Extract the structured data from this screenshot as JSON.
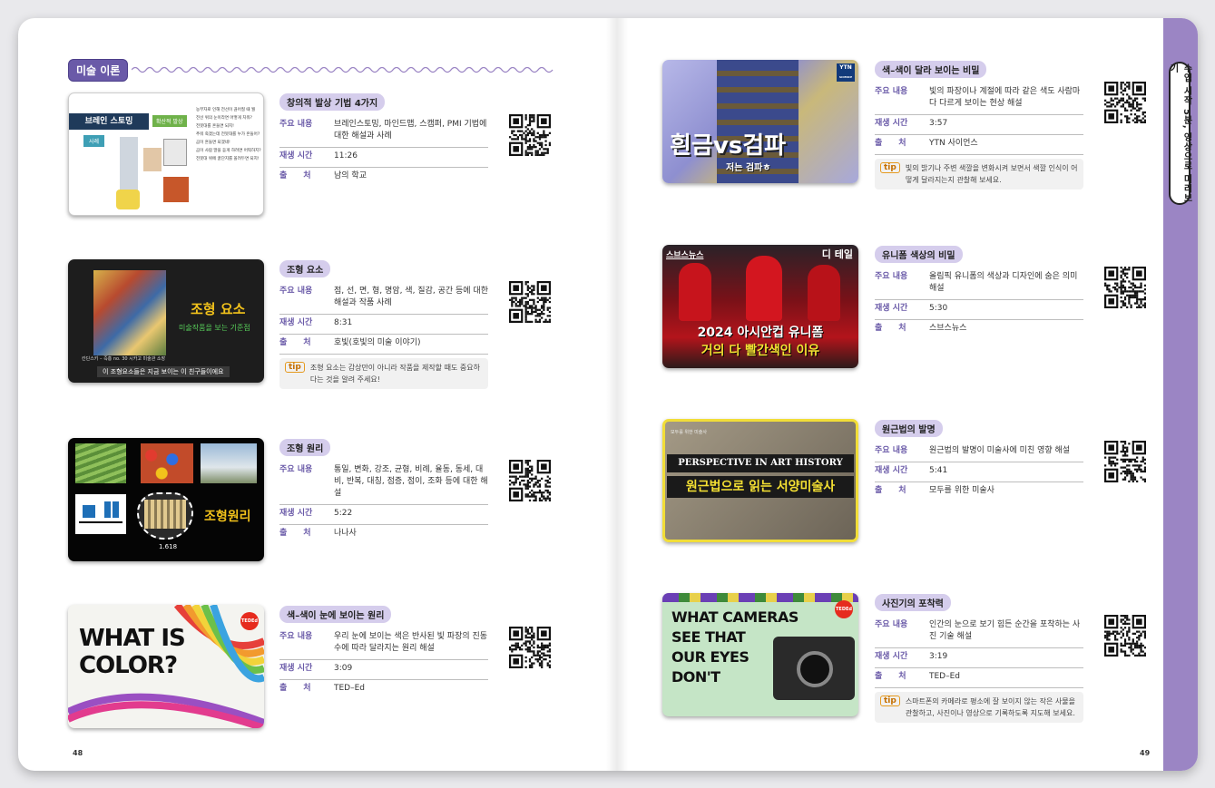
{
  "sidebar": {
    "label": "수업 시작 5분, 영상으로 미리보기"
  },
  "section": {
    "title": "미술 이론"
  },
  "left_entries": [
    {
      "title": "창의적 발상 기법 4가지",
      "content": "브레인스토밍, 마인드맵, 스캠퍼, PMI 기법에 대한 해설과 사례",
      "duration": "11:26",
      "source": "남의 학교",
      "thumb": {
        "heading": "브레인 스토밍",
        "tag": "확산적 발상",
        "side": "사례",
        "lines": [
          "농부자로 인해 전선이 끊어질 때 뭘",
          "전선 위의 눈이라면 어떻게 치워?",
          "전봇대를 흔들면 되지!",
          "추워 죽겠는데 전봇대를 누가 흔들어?",
          "곰이 흔들면 되겠네!",
          "곰이 사람 말을 듣게 하려면 어떡하지?",
          "전봇대 위에 꿀단지를 올려두면 되지!"
        ]
      }
    },
    {
      "title": "조형 요소",
      "content": "점, 선, 면, 형, 명암, 색, 질감, 공간 등에 대한 해설과 작품 사례",
      "duration": "8:31",
      "source": "호빛(호빛의 미술 이야기)",
      "tip": "조형 요소는 감상만이 아니라 작품을 제작할 때도 중요하다는 것을 알려 주세요!",
      "thumb": {
        "main": "조형 요소",
        "sub": "미술작품을 보는 기준점",
        "caption_top": "칸딘스키 – 즉흥 no. 30 시카고 미술관 소장",
        "caption": "이 조형요소들은 지금 보이는 이 친구들이에요"
      }
    },
    {
      "title": "조형 원리",
      "content": "통일, 변화, 강조, 균형, 비례, 율동, 동세, 대비, 반복, 대칭, 점증, 점이, 조화 등에 대한 해설",
      "duration": "5:22",
      "source": "나나사",
      "thumb": {
        "main": "조형원리",
        "ratio": "1.618"
      }
    },
    {
      "title": "색–색이 눈에 보이는 원리",
      "content": "우리 눈에 보이는 색은 반사된 빛 파장의 진동수에 따라 달라지는 원리 해설",
      "duration": "3:09",
      "source": "TED–Ed",
      "thumb": {
        "line1": "WHAT IS",
        "line2": "COLOR?",
        "logo": "TEDEd"
      }
    }
  ],
  "right_entries": [
    {
      "title": "색–색이 달라 보이는 비밀",
      "content": "빛의 파장이나 계절에 따라 같은 색도 사람마다 다르게 보이는 현상 해설",
      "duration": "3:57",
      "source": "YTN 사이언스",
      "tip": "빛의 밝기나 주변 색깔을 변화시켜 보면서 색깔 인식이 어떻게 달라지는지 관찰해 보세요.",
      "thumb": {
        "main": "흰금vs검파",
        "sub": "저는 검파ㅎ",
        "logo": "YTN",
        "logo_sub": "SCIENCE"
      }
    },
    {
      "title": "유니폼 색상의 비밀",
      "content": "올림픽 유니폼의 색상과 디자인에 숨은 의미 해설",
      "duration": "5:30",
      "source": "스브스뉴스",
      "thumb": {
        "logo": "스브스뉴스",
        "tag": "디 테일",
        "line1": "2024 아시안컵 유니폼",
        "line2": "거의 다 빨간색인 이유"
      }
    },
    {
      "title": "원근법의 발명",
      "content": "원근법의 발명이 미술사에 미친 영향 해설",
      "duration": "5:41",
      "source": "모두를 위한 미술사",
      "thumb": {
        "channel": "모두를 위한 미술사",
        "line1": "PERSPECTIVE IN ART HISTORY",
        "line2": "원근법으로 읽는 서양미술사"
      }
    },
    {
      "title": "사진기의 포착력",
      "content": "인간의 눈으로 보기 힘든 순간을 포착하는 사진 기술 해설",
      "duration": "3:19",
      "source": "TED–Ed",
      "tip": "스마트폰의 카메라로 평소에 잘 보이지 않는 작은 사물을 관찰하고, 사진이나 영상으로 기록하도록 지도해 보세요.",
      "thumb": {
        "lines": [
          "WHAT CAMERAS",
          "SEE THAT",
          "OUR EYES",
          "DON'T"
        ],
        "logo": "TEDEd"
      }
    }
  ],
  "labels": {
    "content": "주요 내용",
    "duration": "재생 시간",
    "source": "출　　처",
    "tip": "tip"
  },
  "pages": {
    "left": "48",
    "right": "49"
  }
}
